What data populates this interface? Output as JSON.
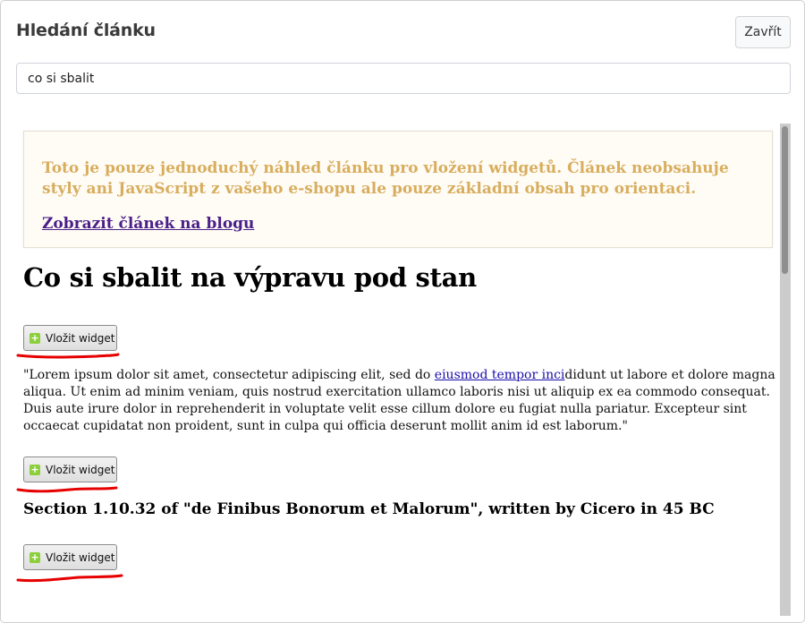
{
  "dialog": {
    "title": "Hledání článku",
    "close_label": "Zavřít"
  },
  "search": {
    "value": "co si sbalit"
  },
  "notice": {
    "text": "Toto je pouze jednoduchý náhled článku pro vložení widgetů. Článek neobsahuje styly ani JavaScript z vašeho e-shopu ale pouze základní obsah pro orientaci.",
    "link_label": "Zobrazit článek na blogu"
  },
  "article": {
    "title": "Co si sbalit na výpravu pod stan",
    "paragraph_before_link": "\"Lorem ipsum dolor sit amet, consectetur adipiscing elit, sed do ",
    "paragraph_link": "eiusmod tempor inci",
    "paragraph_after_link": "didunt ut labore et dolore magna aliqua. Ut enim ad minim veniam, quis nostrud exercitation ullamco laboris nisi ut aliquip ex ea commodo consequat. Duis aute irure dolor in reprehenderit in voluptate velit esse cillum dolore eu fugiat nulla pariatur. Excepteur sint occaecat cupidatat non proident, sunt in culpa qui officia deserunt mollit anim id est laborum.\"",
    "section_heading": "Section 1.10.32 of \"de Finibus Bonorum et Malorum\", written by Cicero in 45 BC"
  },
  "widget_buttons": [
    {
      "label": "Vložit widget"
    },
    {
      "label": "Vložit widget"
    },
    {
      "label": "Vložit widget"
    }
  ],
  "colors": {
    "notice_text": "#d8ad5e",
    "notice_link": "#4b1f8a",
    "plus_icon": "#8ccf3c",
    "annotation_underline": "#e60000"
  },
  "icons": {
    "plus": "plus-icon"
  }
}
